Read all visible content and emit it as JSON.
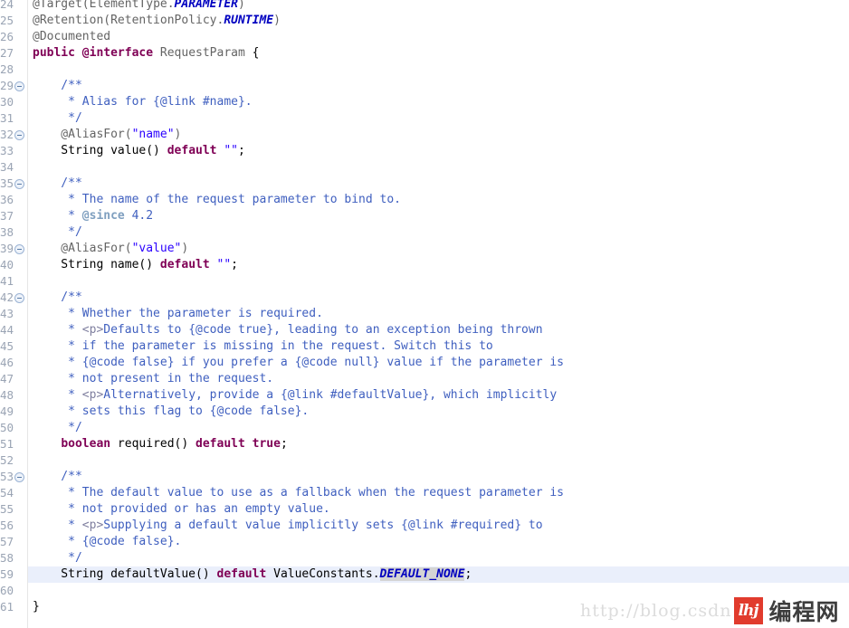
{
  "editor": {
    "file_name": "RequestParam.java",
    "language": "Java",
    "first_line_number": 24,
    "current_line_number": 59,
    "colors": {
      "background": "#ffffff",
      "keyword": "#7f0055",
      "string": "#2a00ff",
      "comment": "#3f5fbf",
      "comment_tag": "#7f9fbf",
      "annotation": "#646464",
      "static_field": "#0000c0",
      "current_line_highlight": "#eaeffb",
      "occurrence_highlight": "#d4d4d4",
      "line_number": "#9aa4b4",
      "gutter_separator": "#e6e6e6"
    },
    "lines": [
      {
        "n": 24,
        "fold": false,
        "current": false,
        "tokens": [
          {
            "t": "@Target(",
            "c": "ann"
          },
          {
            "t": "ElementType.",
            "c": "ann"
          },
          {
            "t": "PARAMETER",
            "c": "field-st"
          },
          {
            "t": ")",
            "c": "ann"
          }
        ]
      },
      {
        "n": 25,
        "fold": false,
        "current": false,
        "tokens": [
          {
            "t": "@Retention(",
            "c": "ann"
          },
          {
            "t": "RetentionPolicy.",
            "c": "ann"
          },
          {
            "t": "RUNTIME",
            "c": "field-st"
          },
          {
            "t": ")",
            "c": "ann"
          }
        ]
      },
      {
        "n": 26,
        "fold": false,
        "current": false,
        "tokens": [
          {
            "t": "@Documented",
            "c": "ann"
          }
        ]
      },
      {
        "n": 27,
        "fold": false,
        "current": false,
        "tokens": [
          {
            "t": "public @interface",
            "c": "kw"
          },
          {
            "t": " ",
            "c": "plain"
          },
          {
            "t": "RequestParam",
            "c": "ann"
          },
          {
            "t": " {",
            "c": "plain"
          }
        ]
      },
      {
        "n": 28,
        "fold": false,
        "current": false,
        "tokens": []
      },
      {
        "n": 29,
        "fold": true,
        "current": false,
        "tokens": [
          {
            "t": "    /**",
            "c": "cmt"
          }
        ]
      },
      {
        "n": 30,
        "fold": false,
        "current": false,
        "tokens": [
          {
            "t": "     * Alias for {@link #name}.",
            "c": "cmt"
          }
        ]
      },
      {
        "n": 31,
        "fold": false,
        "current": false,
        "tokens": [
          {
            "t": "     */",
            "c": "cmt"
          }
        ]
      },
      {
        "n": 32,
        "fold": true,
        "current": false,
        "tokens": [
          {
            "t": "    @AliasFor(",
            "c": "ann"
          },
          {
            "t": "\"name\"",
            "c": "str"
          },
          {
            "t": ")",
            "c": "ann"
          }
        ]
      },
      {
        "n": 33,
        "fold": false,
        "current": false,
        "tokens": [
          {
            "t": "    String value() ",
            "c": "plain"
          },
          {
            "t": "default",
            "c": "kw"
          },
          {
            "t": " ",
            "c": "plain"
          },
          {
            "t": "\"\"",
            "c": "str"
          },
          {
            "t": ";",
            "c": "plain"
          }
        ]
      },
      {
        "n": 34,
        "fold": false,
        "current": false,
        "tokens": []
      },
      {
        "n": 35,
        "fold": true,
        "current": false,
        "tokens": [
          {
            "t": "    /**",
            "c": "cmt"
          }
        ]
      },
      {
        "n": 36,
        "fold": false,
        "current": false,
        "tokens": [
          {
            "t": "     * The name of the request parameter to bind to.",
            "c": "cmt"
          }
        ]
      },
      {
        "n": 37,
        "fold": false,
        "current": false,
        "tokens": [
          {
            "t": "     * ",
            "c": "cmt"
          },
          {
            "t": "@since",
            "c": "cmt-tag"
          },
          {
            "t": " 4.2",
            "c": "cmt"
          }
        ]
      },
      {
        "n": 38,
        "fold": false,
        "current": false,
        "tokens": [
          {
            "t": "     */",
            "c": "cmt"
          }
        ]
      },
      {
        "n": 39,
        "fold": true,
        "current": false,
        "tokens": [
          {
            "t": "    @AliasFor(",
            "c": "ann"
          },
          {
            "t": "\"value\"",
            "c": "str"
          },
          {
            "t": ")",
            "c": "ann"
          }
        ]
      },
      {
        "n": 40,
        "fold": false,
        "current": false,
        "tokens": [
          {
            "t": "    String name() ",
            "c": "plain"
          },
          {
            "t": "default",
            "c": "kw"
          },
          {
            "t": " ",
            "c": "plain"
          },
          {
            "t": "\"\"",
            "c": "str"
          },
          {
            "t": ";",
            "c": "plain"
          }
        ]
      },
      {
        "n": 41,
        "fold": false,
        "current": false,
        "tokens": []
      },
      {
        "n": 42,
        "fold": true,
        "current": false,
        "tokens": [
          {
            "t": "    /**",
            "c": "cmt"
          }
        ]
      },
      {
        "n": 43,
        "fold": false,
        "current": false,
        "tokens": [
          {
            "t": "     * Whether the parameter is required.",
            "c": "cmt"
          }
        ]
      },
      {
        "n": 44,
        "fold": false,
        "current": false,
        "tokens": [
          {
            "t": "     * ",
            "c": "cmt"
          },
          {
            "t": "<p>",
            "c": "cmt-html"
          },
          {
            "t": "Defaults to {@code true}, leading to an exception being thrown",
            "c": "cmt"
          }
        ]
      },
      {
        "n": 45,
        "fold": false,
        "current": false,
        "tokens": [
          {
            "t": "     * if the parameter is missing in the request. Switch this to",
            "c": "cmt"
          }
        ]
      },
      {
        "n": 46,
        "fold": false,
        "current": false,
        "tokens": [
          {
            "t": "     * {@code false} if you prefer a {@code null} value if the parameter is",
            "c": "cmt"
          }
        ]
      },
      {
        "n": 47,
        "fold": false,
        "current": false,
        "tokens": [
          {
            "t": "     * not present in the request.",
            "c": "cmt"
          }
        ]
      },
      {
        "n": 48,
        "fold": false,
        "current": false,
        "tokens": [
          {
            "t": "     * ",
            "c": "cmt"
          },
          {
            "t": "<p>",
            "c": "cmt-html"
          },
          {
            "t": "Alternatively, provide a {@link #defaultValue}, which implicitly",
            "c": "cmt"
          }
        ]
      },
      {
        "n": 49,
        "fold": false,
        "current": false,
        "tokens": [
          {
            "t": "     * sets this flag to {@code false}.",
            "c": "cmt"
          }
        ]
      },
      {
        "n": 50,
        "fold": false,
        "current": false,
        "tokens": [
          {
            "t": "     */",
            "c": "cmt"
          }
        ]
      },
      {
        "n": 51,
        "fold": false,
        "current": false,
        "tokens": [
          {
            "t": "    ",
            "c": "plain"
          },
          {
            "t": "boolean",
            "c": "kw"
          },
          {
            "t": " required() ",
            "c": "plain"
          },
          {
            "t": "default",
            "c": "kw"
          },
          {
            "t": " ",
            "c": "plain"
          },
          {
            "t": "true",
            "c": "kw"
          },
          {
            "t": ";",
            "c": "plain"
          }
        ]
      },
      {
        "n": 52,
        "fold": false,
        "current": false,
        "tokens": []
      },
      {
        "n": 53,
        "fold": true,
        "current": false,
        "tokens": [
          {
            "t": "    /**",
            "c": "cmt"
          }
        ]
      },
      {
        "n": 54,
        "fold": false,
        "current": false,
        "tokens": [
          {
            "t": "     * The default value to use as a fallback when the request parameter is",
            "c": "cmt"
          }
        ]
      },
      {
        "n": 55,
        "fold": false,
        "current": false,
        "tokens": [
          {
            "t": "     * not provided or has an empty value.",
            "c": "cmt"
          }
        ]
      },
      {
        "n": 56,
        "fold": false,
        "current": false,
        "tokens": [
          {
            "t": "     * ",
            "c": "cmt"
          },
          {
            "t": "<p>",
            "c": "cmt-html"
          },
          {
            "t": "Supplying a default value implicitly sets {@link #required} to",
            "c": "cmt"
          }
        ]
      },
      {
        "n": 57,
        "fold": false,
        "current": false,
        "tokens": [
          {
            "t": "     * {@code false}.",
            "c": "cmt"
          }
        ]
      },
      {
        "n": 58,
        "fold": false,
        "current": false,
        "tokens": [
          {
            "t": "     */",
            "c": "cmt"
          }
        ]
      },
      {
        "n": 59,
        "fold": false,
        "current": true,
        "tokens": [
          {
            "t": "    String defaultValue() ",
            "c": "plain"
          },
          {
            "t": "default",
            "c": "kw"
          },
          {
            "t": " ValueConstants.",
            "c": "plain"
          },
          {
            "t": "DEFAULT_NONE",
            "c": "field-hl"
          },
          {
            "t": ";",
            "c": "plain"
          }
        ]
      },
      {
        "n": 60,
        "fold": false,
        "current": false,
        "tokens": []
      },
      {
        "n": 61,
        "fold": false,
        "current": false,
        "tokens": [
          {
            "t": "}",
            "c": "plain"
          }
        ]
      }
    ]
  },
  "watermark": {
    "url_text": "http://blog.csdn",
    "logo_glyph": "lhj",
    "site_name": "编程网",
    "logo_color": "#e13b2d"
  }
}
